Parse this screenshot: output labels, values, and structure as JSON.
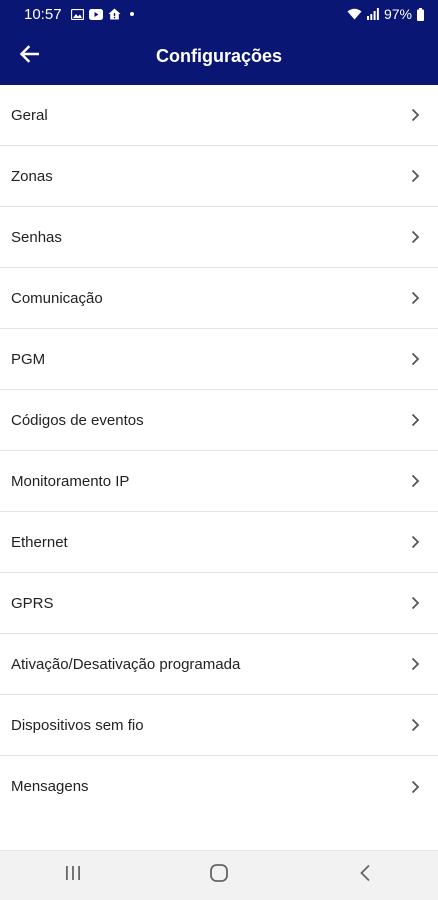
{
  "status_bar": {
    "time": "10:57",
    "battery": "97%",
    "icons": [
      "gallery-icon",
      "youtube-icon",
      "home-alert-icon",
      "wifi-icon",
      "signal-icon",
      "battery-icon"
    ]
  },
  "app_bar": {
    "title": "Configurações",
    "back_icon": "arrow-left-icon"
  },
  "settings": {
    "items": [
      {
        "label": "Geral"
      },
      {
        "label": "Zonas"
      },
      {
        "label": "Senhas"
      },
      {
        "label": "Comunicação"
      },
      {
        "label": "PGM"
      },
      {
        "label": "Códigos de eventos"
      },
      {
        "label": "Monitoramento IP"
      },
      {
        "label": "Ethernet"
      },
      {
        "label": "GPRS"
      },
      {
        "label": "Ativação/Desativação programada"
      },
      {
        "label": "Dispositivos sem fio"
      },
      {
        "label": "Mensagens"
      }
    ]
  },
  "nav_bar": {
    "buttons": [
      "recent-apps-icon",
      "home-icon",
      "back-icon"
    ]
  },
  "colors": {
    "primary": "#0a1673",
    "text": "#222222",
    "divider": "#e4e4e4",
    "nav_bg": "#f2f2f2"
  }
}
